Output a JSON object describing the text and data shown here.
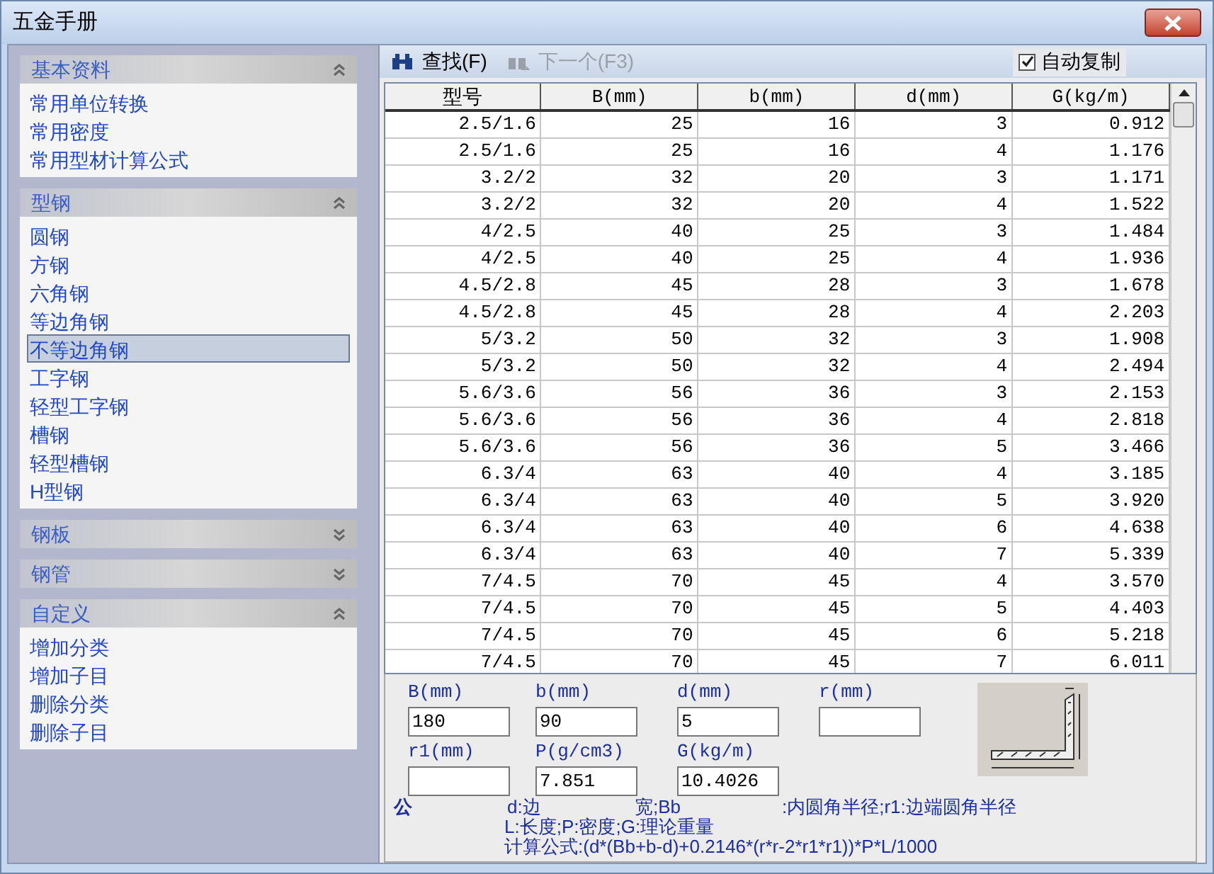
{
  "window": {
    "title": "五金手册"
  },
  "sidebar": {
    "sections": [
      {
        "title": "基本资料",
        "expanded": true,
        "items": [
          {
            "label": "常用单位转换",
            "selected": false
          },
          {
            "label": "常用密度",
            "selected": false
          },
          {
            "label": "常用型材计算公式",
            "selected": false
          }
        ]
      },
      {
        "title": "型钢",
        "expanded": true,
        "items": [
          {
            "label": "圆钢",
            "selected": false
          },
          {
            "label": "方钢",
            "selected": false
          },
          {
            "label": "六角钢",
            "selected": false
          },
          {
            "label": "等边角钢",
            "selected": false
          },
          {
            "label": "不等边角钢",
            "selected": true
          },
          {
            "label": "工字钢",
            "selected": false
          },
          {
            "label": "轻型工字钢",
            "selected": false
          },
          {
            "label": "槽钢",
            "selected": false
          },
          {
            "label": "轻型槽钢",
            "selected": false
          },
          {
            "label": "H型钢",
            "selected": false
          }
        ]
      },
      {
        "title": "钢板",
        "expanded": false
      },
      {
        "title": "钢管",
        "expanded": false
      },
      {
        "title": "自定义",
        "expanded": true,
        "items": [
          {
            "label": "增加分类",
            "selected": false
          },
          {
            "label": "增加子目",
            "selected": false
          },
          {
            "label": "删除分类",
            "selected": false
          },
          {
            "label": "删除子目",
            "selected": false
          }
        ]
      }
    ]
  },
  "toolbar": {
    "find": {
      "label": "查找(F)",
      "disabled": false
    },
    "next": {
      "label": "下一个(F3)",
      "disabled": true
    },
    "auto_copy": {
      "label": "自动复制",
      "checked": true
    }
  },
  "table": {
    "columns": [
      "型号",
      "B(mm)",
      "b(mm)",
      "d(mm)",
      "G(kg/m)"
    ],
    "rows": [
      [
        "2.5/1.6",
        "25",
        "16",
        "3",
        "0.912"
      ],
      [
        "2.5/1.6",
        "25",
        "16",
        "4",
        "1.176"
      ],
      [
        "3.2/2",
        "32",
        "20",
        "3",
        "1.171"
      ],
      [
        "3.2/2",
        "32",
        "20",
        "4",
        "1.522"
      ],
      [
        "4/2.5",
        "40",
        "25",
        "3",
        "1.484"
      ],
      [
        "4/2.5",
        "40",
        "25",
        "4",
        "1.936"
      ],
      [
        "4.5/2.8",
        "45",
        "28",
        "3",
        "1.678"
      ],
      [
        "4.5/2.8",
        "45",
        "28",
        "4",
        "2.203"
      ],
      [
        "5/3.2",
        "50",
        "32",
        "3",
        "1.908"
      ],
      [
        "5/3.2",
        "50",
        "32",
        "4",
        "2.494"
      ],
      [
        "5.6/3.6",
        "56",
        "36",
        "3",
        "2.153"
      ],
      [
        "5.6/3.6",
        "56",
        "36",
        "4",
        "2.818"
      ],
      [
        "5.6/3.6",
        "56",
        "36",
        "5",
        "3.466"
      ],
      [
        "6.3/4",
        "63",
        "40",
        "4",
        "3.185"
      ],
      [
        "6.3/4",
        "63",
        "40",
        "5",
        "3.920"
      ],
      [
        "6.3/4",
        "63",
        "40",
        "6",
        "4.638"
      ],
      [
        "6.3/4",
        "63",
        "40",
        "7",
        "5.339"
      ],
      [
        "7/4.5",
        "70",
        "45",
        "4",
        "3.570"
      ],
      [
        "7/4.5",
        "70",
        "45",
        "5",
        "4.403"
      ],
      [
        "7/4.5",
        "70",
        "45",
        "6",
        "5.218"
      ],
      [
        "7/4.5",
        "70",
        "45",
        "7",
        "6.011"
      ]
    ]
  },
  "form": {
    "fields": [
      {
        "label": "B(mm)",
        "value": "180"
      },
      {
        "label": "b(mm)",
        "value": "90"
      },
      {
        "label": "d(mm)",
        "value": "5"
      },
      {
        "label": "r(mm)"
      },
      {
        "label": "r1(mm)"
      },
      {
        "label": "P(g/cm3)",
        "value": "7.851"
      },
      {
        "label": "G(kg/m)",
        "value": "10.4026"
      }
    ],
    "note_fragments": [
      "公",
      "d:边",
      "宽;Bb",
      ":内圆角半径;r1:边端圆角半径"
    ],
    "note_lines": [
      "L:长度;P:密度;G:理论重量",
      "计算公式:(d*(Bb+b-d)+0.2146*(r*r-2*r1*r1))*P*L/1000"
    ]
  }
}
